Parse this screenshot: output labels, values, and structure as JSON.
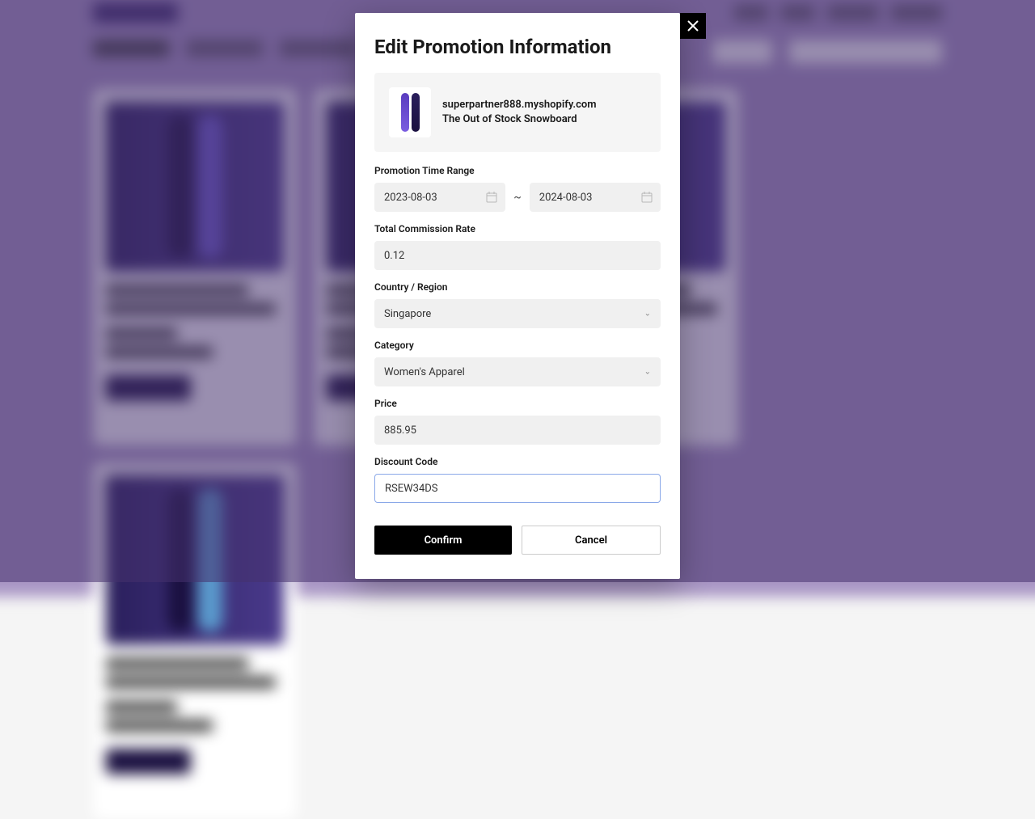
{
  "modal": {
    "title": "Edit Promotion Information",
    "product": {
      "domain": "superpartner888.myshopify.com",
      "name": "The Out of Stock Snowboard"
    },
    "fields": {
      "time_range_label": "Promotion Time Range",
      "start_date": "2023-08-03",
      "end_date": "2024-08-03",
      "separator": "~",
      "commission_label": "Total Commission Rate",
      "commission_value": "0.12",
      "country_label": "Country / Region",
      "country_value": "Singapore",
      "category_label": "Category",
      "category_value": "Women's Apparel",
      "price_label": "Price",
      "price_value": "885.95",
      "discount_label": "Discount Code",
      "discount_value": "RSEW34DS"
    },
    "buttons": {
      "confirm": "Confirm",
      "cancel": "Cancel"
    }
  }
}
